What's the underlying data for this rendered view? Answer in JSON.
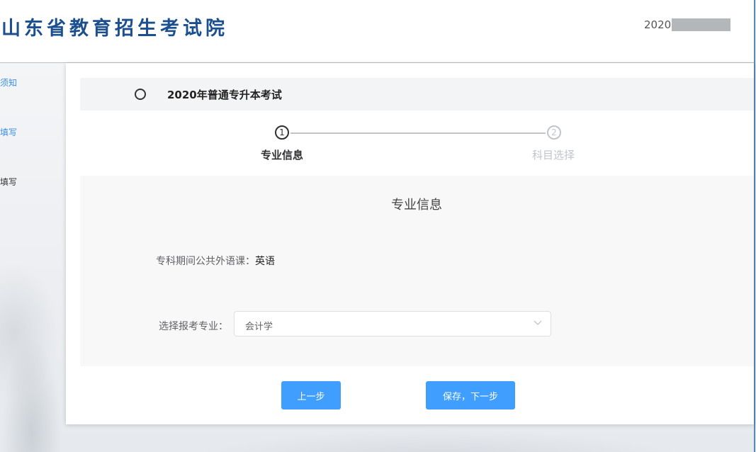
{
  "header": {
    "logo_text": "山东省教育招生考试院",
    "user_id_visible": "2020"
  },
  "sidebar": {
    "items": [
      {
        "label": "须知",
        "state": "active"
      },
      {
        "label": "填写",
        "state": "active"
      },
      {
        "label": "填写",
        "state": "normal"
      }
    ]
  },
  "exam": {
    "title": "2020年普通专升本考试"
  },
  "steps": [
    {
      "number": "1",
      "label": "专业信息",
      "status": "current"
    },
    {
      "number": "2",
      "label": "科目选择",
      "status": "pending"
    }
  ],
  "form": {
    "panel_title": "专业信息",
    "language_label": "专科期间公共外语课：",
    "language_value": "英语",
    "major_label": "选择报考专业：",
    "major_value": "会计学"
  },
  "buttons": {
    "prev_label": "上一步",
    "next_label": "保存，下一步"
  },
  "colors": {
    "logo": "#1b4f8f",
    "accent": "#409eff",
    "sidebar_active": "#3a8ee6",
    "step_pending": "#c0c4cc"
  }
}
